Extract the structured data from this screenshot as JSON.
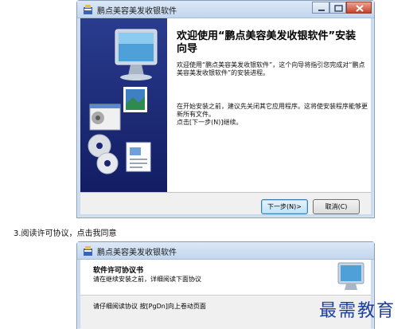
{
  "installer": {
    "title": "鹏点美容美发收银软件",
    "heading": "欢迎使用“鹏点美容美发收银软件”安装向导",
    "intro": "这个向导将指引您完成对“鹏点美容美发收银软件”的安装进程。",
    "intro_prefix": "欢迎使用“鹏点美容美发收银软件”，",
    "advice": "在开始安装之前，建议先关闭其它应用程序。这将使安装程序能够更新所有文件。",
    "instruction": "点击[下一步(N)]继续。",
    "next_button": "下一步(N)>",
    "cancel_button": "取消(C)"
  },
  "step_caption": "3.阅读许可协议，点击我同意",
  "license": {
    "title": "鹏点美容美发收银软件",
    "heading": "软件许可协议书",
    "subheading": "请在继续安装之前，详细阅读下面协议",
    "instruction": "请仔细阅读协议 按[PgDn]向上卷动页面"
  },
  "watermark": "最需教育",
  "colors": {
    "sidebar": "#1a2672",
    "titlebar": "#c9dcf2",
    "close": "#c8432a",
    "watermark": "#1d3f9a"
  }
}
